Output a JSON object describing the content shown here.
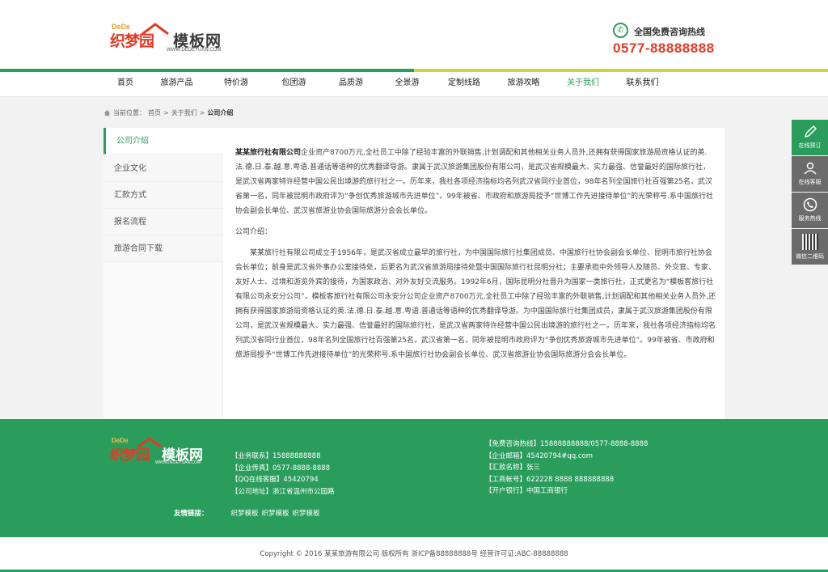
{
  "header": {
    "logo": {
      "dede": "DeDe",
      "zmy": "织梦园",
      "mbw": "模板网",
      "url": "WWW.DEDEYUAN.COM"
    },
    "hotline_label": "全国免费咨询热线",
    "hotline_number": "0577-88888888"
  },
  "nav": {
    "items": [
      {
        "label": "首页"
      },
      {
        "label": "旅游产品"
      },
      {
        "label": "特价游"
      },
      {
        "label": "包团游"
      },
      {
        "label": "品质游"
      },
      {
        "label": "全景游"
      },
      {
        "label": "定制线路"
      },
      {
        "label": "旅游攻略"
      },
      {
        "label": "关于我们"
      },
      {
        "label": "联系我们"
      }
    ],
    "active_index": 8
  },
  "breadcrumb": {
    "prefix": "当前位置：",
    "home": "首页",
    "sep1": " > ",
    "parent": "关于我们",
    "sep2": " > ",
    "current": "公司介绍"
  },
  "sidebar": {
    "items": [
      {
        "label": "公司介绍"
      },
      {
        "label": "企业文化"
      },
      {
        "label": "汇款方式"
      },
      {
        "label": "报名流程"
      },
      {
        "label": "旅游合同下载"
      }
    ]
  },
  "content": {
    "company": "某某旅行社有限公司",
    "para1": "企业资产8700万元,全社员工中除了经验丰富的外联销售,计划调配和其他相关业务人员外,还拥有获得国家旅游局资格认证的英.法.德.日.泰.越.意.粤语.普通话等语种的优秀翻译导游。隶属于武汉旅游集团股份有限公司，是武汉省规模最大、实力最强、信誉最好的国际旅行社，是武汉省两家特许经营中国公民出境游的旅行社之一。历年来，我社各项经济指标均名列武汉省同行业首位，98年名列全国旅行社百强第25名，武汉省第一名，同年被昆明市政府评为“争创优秀旅游城市先进单位”。99年被省、市政府和旅游局授予“世博工作先进接待单位”的光荣称号.系中国旅行社协会副会长单位、武汉省旅游业协会国际旅游分会会长单位。",
    "intro_label": "公司介绍：",
    "para2": "某某旅行社有限公司成立于1956年，是武汉省成立最早的旅行社，为中国国际旅行社集团成员、中国旅行社协会副会长单位、昆明市旅行社协会会长单位；前身是武汉省外事办公室接待处，后更名为武汉省旅游局接待处暨中国国际旅行社昆明分社；主要承担中外领导人及随员、外交官、专家、友好人士、过境和游览外宾的接待，为国家政治、对外友好交流服务。1992年6月，国际昆明分社晋升为国家一类旅行社，正式更名为“模板客旅行社有限公司永安分公司”，模板客旅行社有限公司永安分公司企业资产8700万元,全社员工中除了经验丰富的外联销售,计划调配和其他相关业务人员外,还拥有获得国家旅游局资格认证的英.法.德.日.泰.越.意.粤语.普通话等语种的优秀翻译导游。为中国国际旅行社集团成员，隶属于武汉旅游集团股份有限公司，是武汉省规模最大、实力最强、信誉最好的国际旅行社，是武汉省两家特许经营中国公民出境游的旅行社之一。历年来，我社各项经济指标均名列武汉省同行业首位，98年名列全国旅行社百强第25名，武汉省第一名，同年被昆明市政府评为“争创优秀旅游城市先进单位”。99年被省、市政府和旅游局授予“世博工作先进接待单位”的光荣称号.系中国旅行社协会副会长单位、武汉省旅游业协会国际旅游分会会长单位。"
  },
  "side_float": [
    {
      "label": "在线预订",
      "icon": "pencil-icon"
    },
    {
      "label": "在线客服",
      "icon": "user-icon"
    },
    {
      "label": "服务热线",
      "icon": "phone-icon"
    },
    {
      "label": "微信二维码",
      "icon": "qrcode-icon"
    }
  ],
  "footer": {
    "logo": {
      "dede": "DeDe",
      "zmy": "织梦园",
      "mbw": "模板网",
      "url": "WWW.DEDEYUAN.COM"
    },
    "col1": [
      {
        "k": "【业务联系】",
        "v": "15888888888"
      },
      {
        "k": "【企业传真】",
        "v": "0577-8888-8888"
      },
      {
        "k": "【QQ在线客服】",
        "v": "45420794"
      },
      {
        "k": "【公司地址】",
        "v": "浙江省温州市公园路"
      }
    ],
    "col2": [
      {
        "k": "【免费咨询热线】",
        "v": "15888888888/0577-8888-8888"
      },
      {
        "k": "【企业邮箱】",
        "v": "45420794#qq.com"
      },
      {
        "k": "【汇款名称】",
        "v": "张三"
      },
      {
        "k": "【工商帐号】",
        "v": "622228 8888 888888888"
      },
      {
        "k": "【开户银行】",
        "v": "中国工商银行"
      }
    ],
    "links_label": "友情链接：",
    "links": [
      "织梦模板",
      "织梦模板",
      "织梦模板"
    ]
  },
  "copyright": "Copyright © 2016   某某旅游有限公司   版权所有 浙ICP备88888888号   经营许可证:ABC-88888888",
  "colors": {
    "brand_green": "#2a9d5c",
    "accent_red": "#e23b26",
    "lime": "#c9d540"
  }
}
